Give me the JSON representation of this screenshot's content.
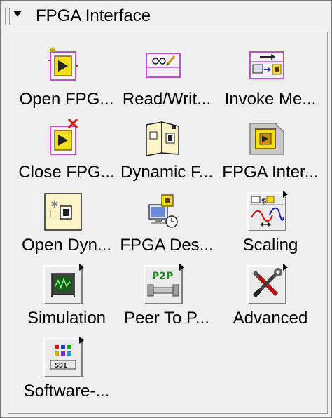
{
  "palette": {
    "title": "FPGA Interface"
  },
  "items": [
    {
      "label": "Open FPG...",
      "icon": "open-fpga-reference-icon"
    },
    {
      "label": "Read/Writ...",
      "icon": "read-write-control-icon"
    },
    {
      "label": "Invoke Me...",
      "icon": "invoke-method-icon"
    },
    {
      "label": "Close FPG...",
      "icon": "close-fpga-reference-icon"
    },
    {
      "label": "Dynamic F...",
      "icon": "dynamic-fpga-interface-cast-icon"
    },
    {
      "label": "FPGA Inter...",
      "icon": "fpga-interface-constant-icon"
    },
    {
      "label": "Open Dyn...",
      "icon": "open-dynamic-bitfile-reference-icon"
    },
    {
      "label": "FPGA Des...",
      "icon": "fpga-desktop-execution-icon"
    },
    {
      "label": "Scaling",
      "icon": "scaling-icon"
    },
    {
      "label": "Simulation",
      "icon": "simulation-icon"
    },
    {
      "label": "Peer To P...",
      "icon": "peer-to-peer-icon"
    },
    {
      "label": "Advanced",
      "icon": "advanced-tools-icon"
    },
    {
      "label": "Software-...",
      "icon": "software-designed-instrument-icon"
    }
  ],
  "colors": {
    "fpga_yellow": "#f2e01e",
    "fpga_purple": "#c050c8",
    "close_red": "#e01010",
    "p2p_green": "#2a8a2a",
    "scaling_blue": "#2020c0"
  }
}
